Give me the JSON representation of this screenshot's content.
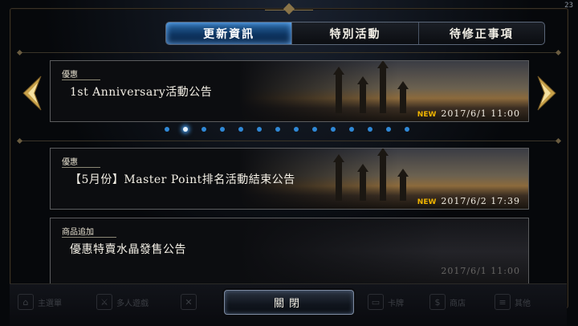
{
  "status": {
    "time": "23"
  },
  "tabs": [
    {
      "label": "更新資訊",
      "active": true
    },
    {
      "label": "特別活動",
      "active": false
    },
    {
      "label": "待修正事項",
      "active": false
    }
  ],
  "featured": {
    "category": "優惠",
    "title": "1st Anniversary活動公告",
    "new_label": "NEW",
    "date": "2017/6/1 11:00"
  },
  "pagination": {
    "count": 14,
    "current": 2
  },
  "news": [
    {
      "category": "優惠",
      "title": "【5月份】Master Point排名活動結束公告",
      "new_label": "NEW",
      "date": "2017/6/2 17:39"
    },
    {
      "category": "商品追加",
      "title": "優惠特賣水晶發售公告",
      "date": "2017/6/1 11:00"
    }
  ],
  "bottom_nav": [
    {
      "label": "主選單",
      "icon": "home-icon"
    },
    {
      "label": "多人遊戲",
      "icon": "swords-icon"
    },
    {
      "label": "",
      "icon": "cross-icon"
    },
    {
      "label": "卡牌",
      "icon": "card-icon"
    },
    {
      "label": "商店",
      "icon": "shop-icon"
    },
    {
      "label": "其他",
      "icon": "menu-icon"
    }
  ],
  "close_button": {
    "label": "關閉"
  }
}
